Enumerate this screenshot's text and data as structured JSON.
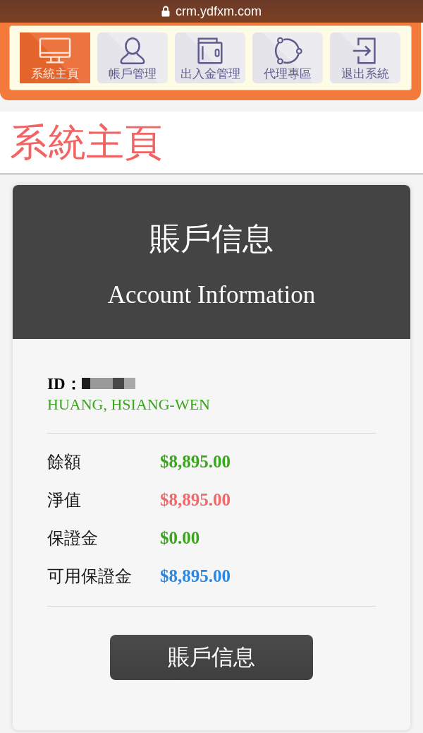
{
  "browser_bar": {
    "url": "crm.ydfxm.com"
  },
  "nav": {
    "items": [
      {
        "label": "系統主頁",
        "selected": true
      },
      {
        "label": "帳戶管理",
        "selected": false
      },
      {
        "label": "出入金管理",
        "selected": false
      },
      {
        "label": "代理專區",
        "selected": false
      },
      {
        "label": "退出系統",
        "selected": false
      }
    ]
  },
  "page_title": "系統主頁",
  "account_card": {
    "title": "賬戶信息",
    "subtitle": "Account Information",
    "id_label": "ID：",
    "name": "HUANG, HSIANG-WEN",
    "rows": [
      {
        "label": "餘額",
        "value": "$8,895.00",
        "color": "#3aa61e"
      },
      {
        "label": "淨值",
        "value": "$8,895.00",
        "color": "#ef6a6a"
      },
      {
        "label": "保證金",
        "value": "$0.00",
        "color": "#3aa61e"
      },
      {
        "label": "可用保證金",
        "value": "$8,895.00",
        "color": "#2b87e3"
      }
    ],
    "button": "賬戶信息"
  }
}
